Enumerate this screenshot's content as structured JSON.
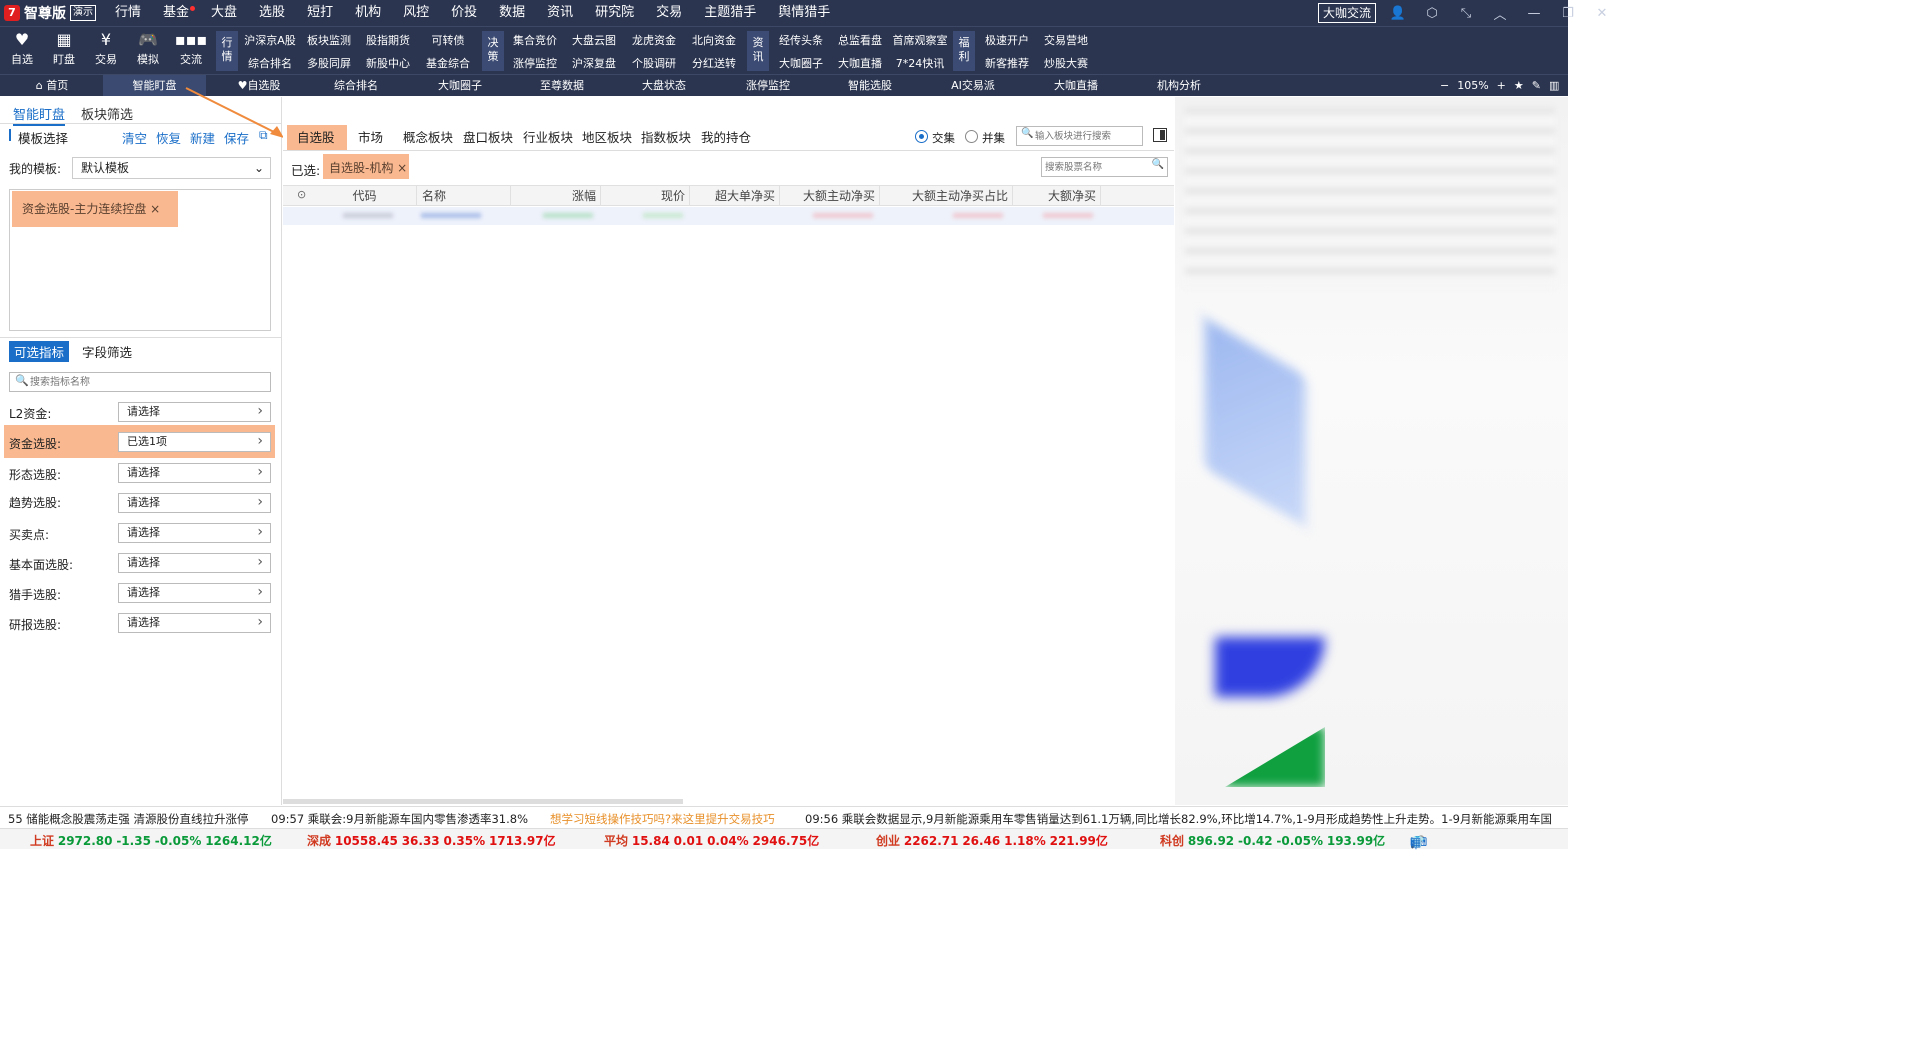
{
  "app": {
    "title": "智尊版",
    "mode_badge": "演示"
  },
  "menu": [
    "行情",
    "基金",
    "大盘",
    "选股",
    "短打",
    "机构",
    "风控",
    "价投",
    "数据",
    "资讯",
    "研究院",
    "交易",
    "主题猎手",
    "舆情猎手"
  ],
  "top_button": "大咖交流",
  "toolbar": {
    "big": [
      {
        "label": "自选",
        "icon": "heart-icon"
      },
      {
        "label": "盯盘",
        "icon": "chart-icon"
      },
      {
        "label": "交易",
        "icon": "yen-icon"
      },
      {
        "label": "模拟",
        "icon": "gamepad-icon"
      },
      {
        "label": "交流",
        "icon": "chat-icon"
      }
    ],
    "group1_tag": "行\n情",
    "group1": [
      "沪深京A股",
      "板块监测",
      "股指期货",
      "可转债",
      "综合排名",
      "多股同屏",
      "新股中心",
      "基金综合"
    ],
    "group2_tag": "决\n策",
    "group2": [
      "集合竞价",
      "大盘云图",
      "龙虎资金",
      "北向资金",
      "涨停监控",
      "沪深复盘",
      "个股调研",
      "分红送转"
    ],
    "group3_tag": "资\n讯",
    "group3": [
      "经传头条",
      "总监看盘",
      "首席观察室",
      "大咖圈子",
      "大咖直播",
      "7*24快讯"
    ],
    "group4_tag": "福\n利",
    "group4": [
      "极速开户",
      "交易营地",
      "新客推荐",
      "炒股大赛"
    ]
  },
  "tabs": [
    "首页",
    "智能盯盘",
    "自选股",
    "综合排名",
    "大咖圈子",
    "至尊数据",
    "大盘状态",
    "涨停监控",
    "智能选股",
    "AI交易派",
    "大咖直播",
    "机构分析"
  ],
  "zoom": "105%",
  "left": {
    "tabs": [
      "智能盯盘",
      "板块筛选"
    ],
    "template_header": "模板选择",
    "actions": [
      "清空",
      "恢复",
      "新建",
      "保存"
    ],
    "my_template_label": "我的模板:",
    "my_template_value": "默认模板",
    "chosen_tag": "资金选股-主力连续控盘",
    "indicator_tabs": [
      "可选指标",
      "字段筛选"
    ],
    "search_placeholder": "搜索指标名称",
    "rows": [
      {
        "label": "L2资金:",
        "value": "请选择"
      },
      {
        "label": "资金选股:",
        "value": "已选1项"
      },
      {
        "label": "形态选股:",
        "value": "请选择"
      },
      {
        "label": "趋势选股:",
        "value": "请选择"
      },
      {
        "label": "买卖点:",
        "value": "请选择"
      },
      {
        "label": "基本面选股:",
        "value": "请选择"
      },
      {
        "label": "猎手选股:",
        "value": "请选择"
      },
      {
        "label": "研报选股:",
        "value": "请选择"
      }
    ]
  },
  "main": {
    "tabs": [
      "自选股",
      "市场",
      "概念板块",
      "盘口板块",
      "行业板块",
      "地区板块",
      "指数板块",
      "我的持仓"
    ],
    "radio_intersection": "交集",
    "radio_union": "并集",
    "block_search_placeholder": "输入板块进行搜索",
    "selected_label": "已选:",
    "selected_tag": "自选股-机构",
    "stock_search_placeholder": "搜索股票名称",
    "columns": [
      "代码",
      "名称",
      "涨幅",
      "现价",
      "超大单净买",
      "大额主动净买",
      "大额主动净买占比",
      "大额净买"
    ]
  },
  "news": [
    "55 储能概念股震荡走强 清源股份直线拉升涨停",
    "09:57 乘联会:9月新能源车国内零售渗透率31.8%",
    "想学习短线操作技巧吗?来这里提升交易技巧",
    "09:56 乘联会数据显示,9月新能源乘用车零售销量达到61.1万辆,同比增长82.9%,环比增14.7%,1-9月形成趋势性上升走势。1-9月新能源乘用车国"
  ],
  "indices": [
    {
      "name": "上证",
      "value": "2972.80",
      "change": "-1.35",
      "pct": "-0.05%",
      "amount": "1264.12亿"
    },
    {
      "name": "深成",
      "value": "10558.45",
      "change": "36.33",
      "pct": "0.35%",
      "amount": "1713.97亿"
    },
    {
      "name": "平均",
      "value": "15.84",
      "change": "0.01",
      "pct": "0.04%",
      "amount": "2946.75亿"
    },
    {
      "name": "创业",
      "value": "2262.71",
      "change": "26.46",
      "pct": "1.18%",
      "amount": "221.99亿"
    },
    {
      "name": "科创",
      "value": "896.92",
      "change": "-0.42",
      "pct": "-0.05%",
      "amount": "193.99亿"
    }
  ],
  "ime": "中",
  "colors": {
    "accent_orange": "#f9b88f",
    "header_bg": "#2b3550",
    "link_blue": "#1a6ec8"
  }
}
